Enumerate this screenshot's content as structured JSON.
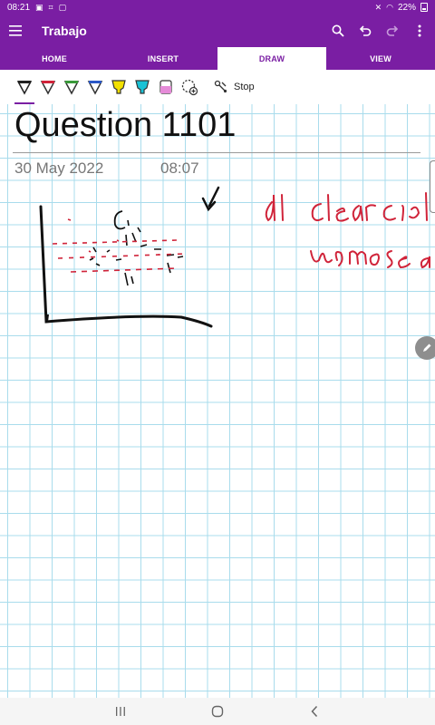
{
  "status_bar": {
    "time": "08:21",
    "battery": "22%"
  },
  "app": {
    "title": "Trabajo"
  },
  "tabs": [
    {
      "label": "HOME"
    },
    {
      "label": "INSERT"
    },
    {
      "label": "DRAW"
    },
    {
      "label": "VIEW"
    }
  ],
  "toolbar": {
    "stop_label": "Stop",
    "pens": [
      {
        "name": "pen-black",
        "color": "#222222"
      },
      {
        "name": "pen-red",
        "color": "#d0243a"
      },
      {
        "name": "pen-green",
        "color": "#3a9a3a"
      },
      {
        "name": "pen-blue",
        "color": "#2b58c7"
      },
      {
        "name": "highlighter-yellow",
        "color": "#f2e000"
      },
      {
        "name": "highlighter-cyan",
        "color": "#19c2d6"
      },
      {
        "name": "highlighter-pink",
        "color": "#e58bd8"
      }
    ]
  },
  "page": {
    "title": "Question 1101",
    "date": "30 May 2022",
    "time": "08:07"
  },
  "colors": {
    "brand": "#7a1ea3",
    "grid": "#a9dcec",
    "ink_black": "#111111",
    "ink_red": "#d0243a"
  }
}
